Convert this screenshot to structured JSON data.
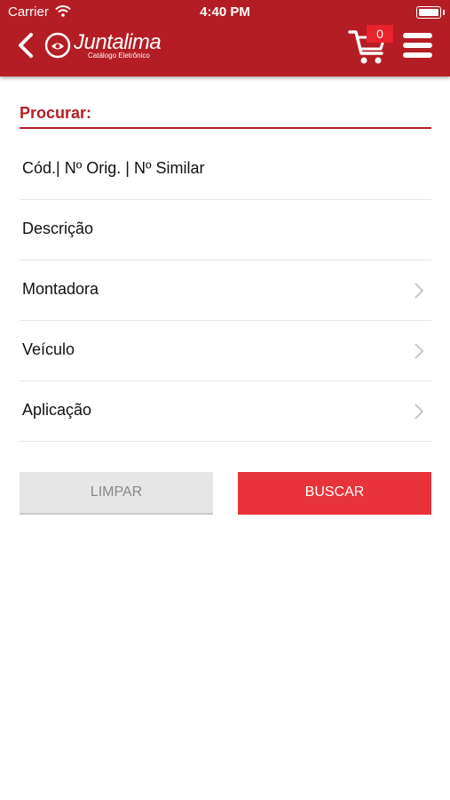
{
  "status_bar": {
    "carrier": "Carrier",
    "time": "4:40 PM"
  },
  "header": {
    "brand_name": "Juntalima",
    "brand_subtitle": "Catálogo Eletrônico",
    "cart_count": "0"
  },
  "search": {
    "title": "Procurar:",
    "fields": [
      {
        "label": "Cód.| Nº Orig. | Nº Similar"
      },
      {
        "label": "Descrição"
      },
      {
        "label": "Montadora"
      },
      {
        "label": "Veículo"
      },
      {
        "label": "Aplicação"
      }
    ]
  },
  "actions": {
    "clear_label": "LIMPAR",
    "search_label": "BUSCAR"
  },
  "colors": {
    "brand_red": "#b51d24",
    "button_red": "#e8333b",
    "badge_red": "#e8232b"
  }
}
